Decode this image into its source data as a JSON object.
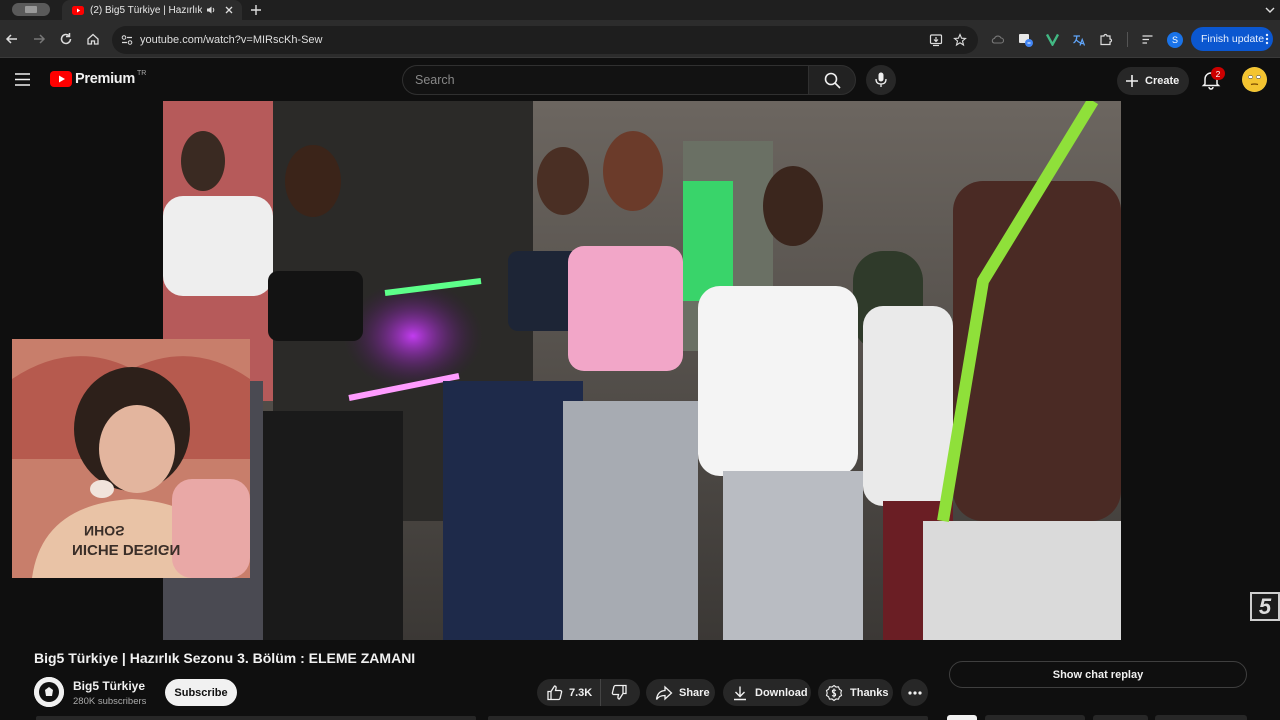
{
  "browser": {
    "tab_title": "(2) Big5 Türkiye | Hazırlık",
    "url": "youtube.com/watch?v=MIRscKh-Sew",
    "finish_update_label": "Finish update",
    "profile_initial": "S"
  },
  "header": {
    "logo_text": "Premium",
    "country_code": "TR",
    "search_placeholder": "Search",
    "create_label": "Create",
    "notification_count": "2"
  },
  "video": {
    "title": "Big5 Türkiye | Hazırlık Sezonu 3. Bölüm : ELEME ZAMANI",
    "channel_name": "Big5 Türkiye",
    "subscribers": "280K subscribers",
    "subscribe_label": "Subscribe",
    "likes": "7.3K",
    "share_label": "Share",
    "download_label": "Download",
    "thanks_label": "Thanks",
    "chat_replay_label": "Show chat replay",
    "watermark_text": "5",
    "shirt_text_line1": "NHOS",
    "shirt_text_line2": "NICHE DESIGN"
  },
  "colors": {
    "background": "#0f0f0f",
    "accent_red": "#ff0000",
    "update_blue": "#0b57d0",
    "pill_bg": "#272727"
  }
}
